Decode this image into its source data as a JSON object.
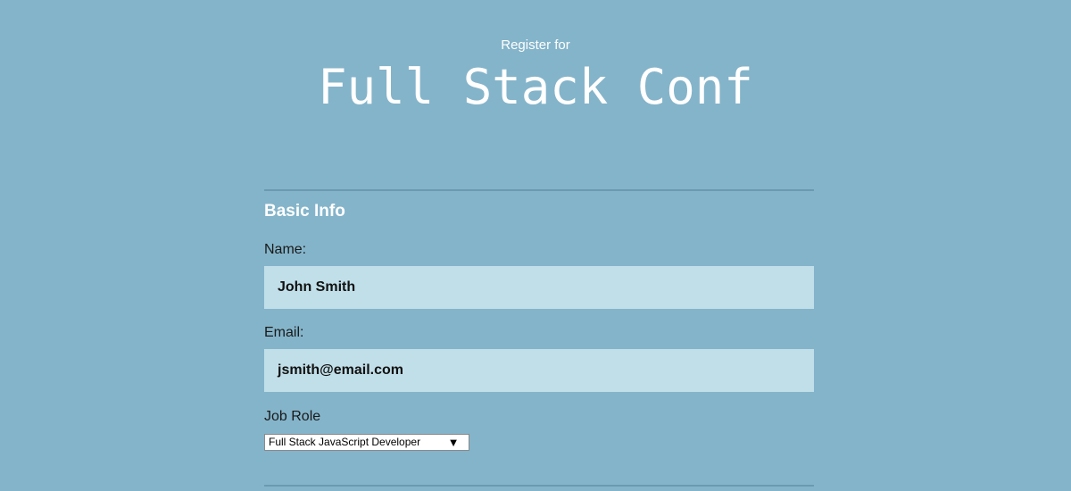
{
  "header": {
    "subtitle": "Register for",
    "title": "Full Stack Conf"
  },
  "form": {
    "section_title": "Basic Info",
    "name": {
      "label": "Name:",
      "value": "John Smith"
    },
    "email": {
      "label": "Email:",
      "value": "jsmith@email.com"
    },
    "job_role": {
      "label": "Job Role",
      "selected": "Full Stack JavaScript Developer",
      "arrow_icon": "triangle-down-icon"
    }
  },
  "colors": {
    "background": "#84b4ca",
    "input_background": "#c1dfe9",
    "divider": "#6b9ab0",
    "heading_text": "#ffffff"
  }
}
